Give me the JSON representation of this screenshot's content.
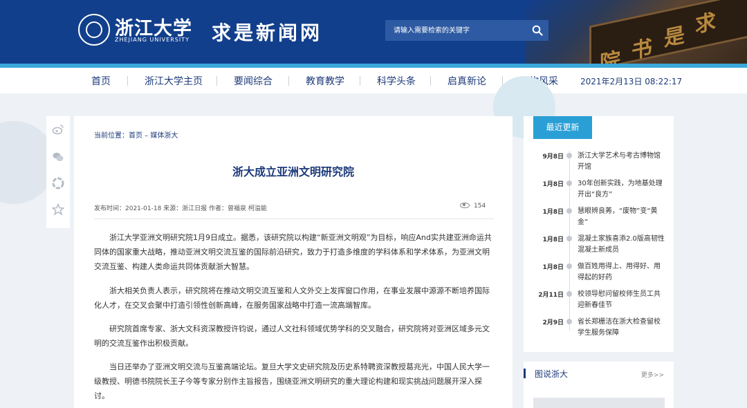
{
  "header": {
    "logo_cn": "浙江大学",
    "logo_en": "ZHEJIANG UNIVERSITY",
    "site_title": "求是新闻网",
    "search_placeholder": "请输入需要检索的关键字",
    "photo_board_text": [
      "求",
      "是",
      "书",
      "院"
    ]
  },
  "nav": {
    "items": [
      "首页",
      "浙江大学主页",
      "要闻综合",
      "教育教学",
      "科学头条",
      "启真新论",
      "人物风采"
    ],
    "datetime": "2021年2月13日  08:22:17"
  },
  "share": {
    "icons": [
      "weibo-icon",
      "wechat-icon",
      "moments-icon",
      "favorite-icon"
    ]
  },
  "article": {
    "breadcrumb_prefix": "当前位置：",
    "breadcrumb_home": "首页",
    "breadcrumb_sep": " – ",
    "breadcrumb_section": "媒体浙大",
    "title": "浙大成立亚洲文明研究院",
    "meta": "发布时间：2021-01-18    来源：浙江日报    作者：曾福泉 柯溢能",
    "views": "154",
    "paragraphs": [
      "浙江大学亚洲文明研究院1月9日成立。据悉，该研究院以构建“新亚洲文明观”为目标，响应And实共建亚洲命运共同体的国家重大战略，推动亚洲文明交流互鉴的国际前沿研究，致力于打造多维度的学科体系和学术体系，为亚洲文明交流互鉴、构建人类命运共同体贡献浙大智慧。",
      "浙大相关负责人表示，研究院将在推动文明交流互鉴和人文外交上发挥窗口作用，在事业发展中源源不断培养国际化人才，在交叉会聚中打造引领性创新高峰，在服务国家战略中打造一流高端智库。",
      "研究院首席专家、浙大文科资深教授许钧说，通过人文社科领域优势学科的交叉融合，研究院将对亚洲区域多元文明的交流互鉴作出积极贡献。",
      "当日还举办了亚洲文明交流与互鉴高端论坛。复旦大学文史研究院及历史系特聘资深教授葛兆光，中国人民大学一级教授、明德书院院长王子今等专家分别作主旨报告，围绕亚洲文明研究的重大理论构建和现实挑战问题展开深入探讨。"
    ]
  },
  "latest": {
    "tab_label": "最近更新",
    "items": [
      {
        "date": "9月8日",
        "text": "浙江大学艺术与考古博物馆开馆"
      },
      {
        "date": "1月8日",
        "text": "30年创新实践，为地基处理开出“良方”"
      },
      {
        "date": "1月8日",
        "text": "慧眼辨良莠，“废物”变“黄金”"
      },
      {
        "date": "1月8日",
        "text": "混凝土家族喜添2.0版高韧性混凝土新成员"
      },
      {
        "date": "1月8日",
        "text": "做百姓用得上、用得好、用得起的好药"
      },
      {
        "date": "2月11日",
        "text": "校领导慰问留校师生员工共迎新春佳节"
      },
      {
        "date": "2月9日",
        "text": "省长郑栅洁在浙大检查留校学生服务保障"
      }
    ]
  },
  "pics": {
    "title": "图说浙大",
    "more": "更多>>"
  },
  "colors": {
    "header_blue": "#123f8c",
    "accent_cyan": "#2a9fd6",
    "nav_text": "#1d3a7a"
  }
}
